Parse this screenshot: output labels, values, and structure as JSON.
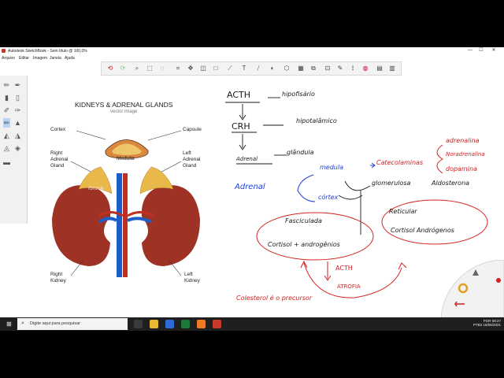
{
  "window": {
    "title": "Autodesk SketchBook - Sem título @ 100,0%",
    "controls": [
      "—",
      "☐",
      "✕"
    ]
  },
  "menu": [
    "Arquivo",
    "Editar",
    "Imagem",
    "Janela",
    "Ajuda"
  ],
  "toolbar_icons": [
    "undo-icon",
    "redo-icon",
    "zoom-icon",
    "select-icon",
    "lasso-icon",
    "crop-icon",
    "transform-icon",
    "ruler-icon",
    "ellipse-icon",
    "shape-icon",
    "text-icon",
    "perspective-icon",
    "symmetry-icon",
    "brush-icon",
    "copic-icon",
    "layers-icon",
    "grid-icon",
    "pen-icon",
    "stroke-icon",
    "color-wheel-icon",
    "palette-icon",
    "layer-editor-icon"
  ],
  "reference_image": {
    "title": "KIDNEYS & ADRENAL GLANDS",
    "subtitle": "vector image",
    "labels": {
      "cortex": "Cortex",
      "capsule": "Capsule",
      "medulla": "Medulla",
      "right_adrenal": [
        "Right",
        "Adrenal",
        "Gland"
      ],
      "left_adrenal": [
        "Left",
        "Adrenal",
        "Gland"
      ],
      "right_kidney": [
        "Right",
        "Kidney"
      ],
      "left_kidney": [
        "Left",
        "Kidney"
      ]
    },
    "watermark": "iStock"
  },
  "notes": {
    "acth": "ACTH",
    "hipofisario": "hipofisário",
    "crh": "CRH",
    "hipotalamico": "hipotalâmico",
    "adrenal_small": "Adrenal",
    "glandula": "glândula",
    "adrenal": "Adrenal",
    "medula": "medula",
    "catecolaminas": "Catecolaminas",
    "adrenalina": "adrenalina",
    "noradrenalina": "Noradrenalina",
    "dopamina": "dopamina",
    "cortex": "córtex",
    "glomerulosa": "glomerulosa",
    "aldosterona": "Aldosterona",
    "fasciculada": "Fasciculada",
    "cortisol_andro_1": "Cortisol + androgênios",
    "reticular": "Reticular",
    "cortisol_andro_2": "Cortisol Andrógenos",
    "acth2": "ACTH",
    "atrofia": "ATROFIA",
    "colesterol": "Colesterol é o precursor"
  },
  "taskbar": {
    "search_placeholder": "Digite aqui para pesquisar",
    "lang": "POR",
    "lang2": "PTB2",
    "time": "08:27",
    "date": "16/06/2021"
  },
  "colors": {
    "ink_black": "#1a1a1a",
    "ink_blue": "#1f3fd6",
    "ink_red": "#d42020",
    "kidney": "#9e3325",
    "adrenal": "#e9b84a",
    "vein": "#1e5cc8",
    "artery": "#c0301f"
  }
}
